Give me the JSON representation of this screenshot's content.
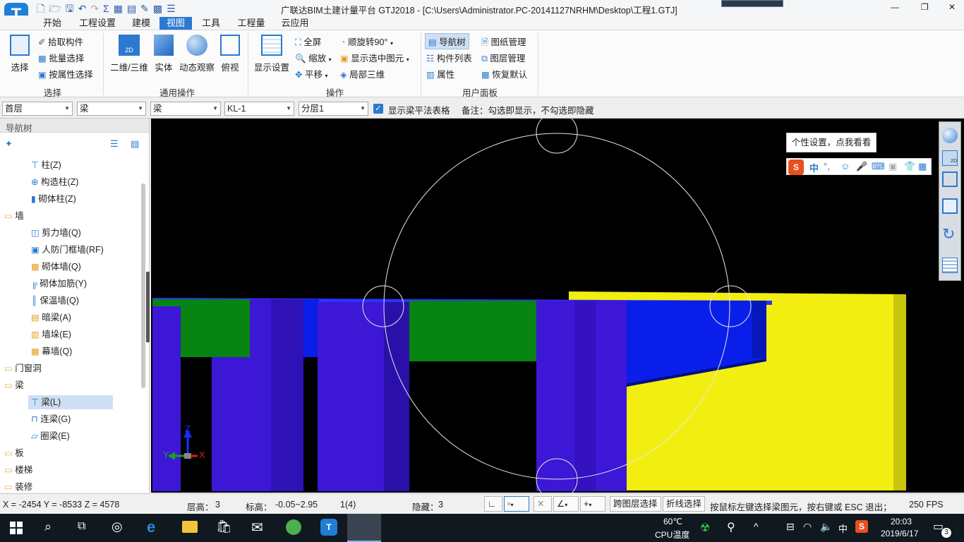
{
  "titlebar": {
    "title": "广联达BIM土建计量平台 GTJ2018 - [C:\\Users\\Administrator.PC-20141127NRHM\\Desktop\\工程1.GTJ]",
    "min": "—",
    "restore": "❐",
    "close": "✕"
  },
  "tabs": [
    "开始",
    "工程设置",
    "建模",
    "视图",
    "工具",
    "工程量",
    "云应用"
  ],
  "active_tab": "视图",
  "ribbon": {
    "select": {
      "label": "选择",
      "pick": "拾取构件",
      "batch": "批量选择",
      "by_attr": "按属性选择",
      "group": "选择"
    },
    "common": {
      "view23": "二维/三维",
      "solid": "实体",
      "dynamic": "动态观察",
      "top": "俯视",
      "group": "通用操作"
    },
    "ops": {
      "display": "显示设置",
      "fullscreen": "全屏",
      "zoom": "缩放",
      "pan": "平移",
      "rotate": "顺旋转90°",
      "show_selected": "显示选中图元",
      "local3d": "局部三维",
      "group": "操作"
    },
    "panel": {
      "navtree": "导航树",
      "complist": "构件列表",
      "attr": "属性",
      "drawmgr": "图纸管理",
      "layermgr": "图层管理",
      "restore": "恢复默认",
      "group": "用户面板"
    }
  },
  "filters": {
    "floor": "首层",
    "type1": "梁",
    "type2": "梁",
    "comp": "KL-1",
    "layer": "分层1",
    "checkbox_label": "显示梁平法表格",
    "checked": true,
    "note": "备注：勾选即显示，不勾选即隐藏"
  },
  "nav": {
    "title": "导航树",
    "items": [
      {
        "label": "柱(Z)",
        "level": 2
      },
      {
        "label": "构造柱(Z)",
        "level": 2
      },
      {
        "label": "砌体柱(Z)",
        "level": 2
      },
      {
        "label": "墙",
        "level": 1
      },
      {
        "label": "剪力墙(Q)",
        "level": 2
      },
      {
        "label": "人防门框墙(RF)",
        "level": 2
      },
      {
        "label": "砌体墙(Q)",
        "level": 2
      },
      {
        "label": "砌体加筋(Y)",
        "level": 2
      },
      {
        "label": "保温墙(Q)",
        "level": 2
      },
      {
        "label": "暗梁(A)",
        "level": 2
      },
      {
        "label": "墙垛(E)",
        "level": 2
      },
      {
        "label": "幕墙(Q)",
        "level": 2
      },
      {
        "label": "门窗洞",
        "level": 1
      },
      {
        "label": "梁",
        "level": 1
      },
      {
        "label": "梁(L)",
        "level": 2
      },
      {
        "label": "连梁(G)",
        "level": 2
      },
      {
        "label": "圈梁(E)",
        "level": 2
      },
      {
        "label": "板",
        "level": 1
      },
      {
        "label": "楼梯",
        "level": 1
      },
      {
        "label": "装修",
        "level": 1
      }
    ],
    "selected": "梁(L)"
  },
  "canvas": {
    "tooltip": "个性设置，点我看看",
    "ime_chars": [
      "中",
      "°,"
    ],
    "axis": {
      "z": "Z",
      "y": "Y",
      "x": "X"
    },
    "view_badge": "2D"
  },
  "colors": {
    "accent": "#2b79d0",
    "blue": "#0a1eea",
    "purple": "#3d17d6",
    "green": "#078412",
    "yellow": "#f2ef10"
  },
  "status": {
    "coords": "X = -2454 Y = -8533 Z = 4578",
    "floor_h_label": "层高：",
    "floor_h": "3",
    "elev_label": "标高：",
    "elev": "-0.05~2.95",
    "count": "1(4)",
    "hidden_label": "隐藏：",
    "hidden": "3",
    "cross_layer": "跨图层选择",
    "polyline": "折线选择",
    "hint": "按鼠标左键选择梁图元，按右键或 ESC 退出；可以通",
    "fps": "250 FPS"
  },
  "taskbar": {
    "cpu_temp": "60℃",
    "cpu_label": "CPU温度",
    "ime": "中",
    "time": "20:03",
    "date": "2019/6/17",
    "notif": "3"
  }
}
